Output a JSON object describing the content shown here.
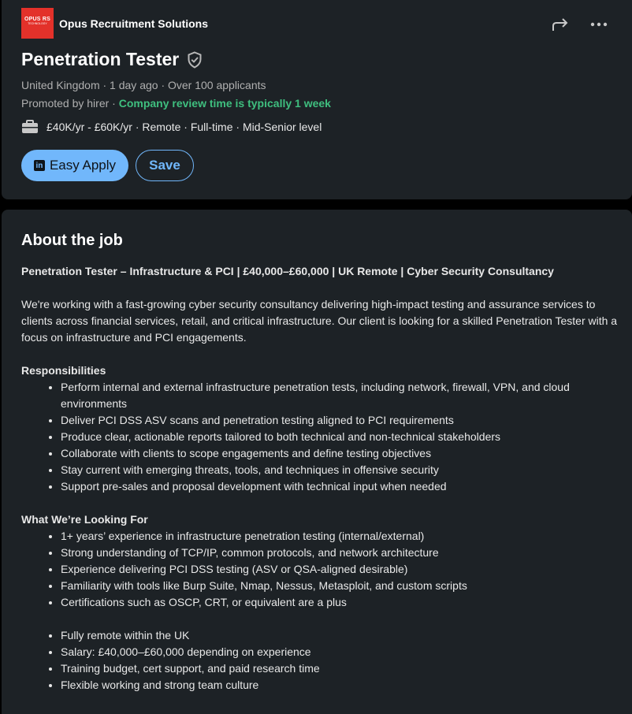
{
  "company": {
    "name": "Opus Recruitment Solutions",
    "logo_line1": "OPUS RS",
    "logo_line2": "TECHNOLOGY"
  },
  "job": {
    "title": "Penetration Tester",
    "meta": "United Kingdom · 1 day ago · Over 100 applicants",
    "promoted_prefix": "Promoted by hirer · ",
    "review_time": "Company review time is typically 1 week",
    "insight": "£40K/yr - £60K/yr · Remote · Full-time · Mid-Senior level"
  },
  "actions": {
    "apply_label": "Easy Apply",
    "apply_logo": "in",
    "save_label": "Save"
  },
  "about": {
    "heading": "About the job",
    "headline": "Penetration Tester – Infrastructure & PCI | £40,000–£60,000 | UK Remote | Cyber Security Consultancy",
    "intro": "We're working with a fast-growing cyber security consultancy delivering high-impact testing and assurance services to clients across financial services, retail, and critical infrastructure. Our client is looking for a skilled Penetration Tester with a focus on infrastructure and PCI engagements.",
    "responsibilities_heading": "Responsibilities",
    "responsibilities": [
      "Perform internal and external infrastructure penetration tests, including network, firewall, VPN, and cloud environments",
      "Deliver PCI DSS ASV scans and penetration testing aligned to PCI requirements",
      "Produce clear, actionable reports tailored to both technical and non-technical stakeholders",
      "Collaborate with clients to scope engagements and define testing objectives",
      "Stay current with emerging threats, tools, and techniques in offensive security",
      "Support pre-sales and proposal development with technical input when needed"
    ],
    "looking_heading": "What We’re Looking For",
    "looking": [
      "1+ years’ experience in infrastructure penetration testing (internal/external)",
      "Strong understanding of TCP/IP, common protocols, and network architecture",
      "Experience delivering PCI DSS testing (ASV or QSA-aligned desirable)",
      "Familiarity with tools like Burp Suite, Nmap, Nessus, Metasploit, and custom scripts",
      "Certifications such as OSCP, CRT, or equivalent are a plus"
    ],
    "benefits": [
      "Fully remote within the UK",
      "Salary: £40,000–£60,000 depending on experience",
      "Training budget, cert support, and paid research time",
      "Flexible working and strong team culture"
    ]
  },
  "icons": {
    "share": "share-icon",
    "more": "more-icon",
    "verified": "verified-shield-icon",
    "briefcase": "briefcase-icon"
  },
  "colors": {
    "background": "#000000",
    "card": "#1d2226",
    "accent_blue": "#71b7fb",
    "green": "#3fbf7f",
    "logo_red": "#e3312a"
  }
}
